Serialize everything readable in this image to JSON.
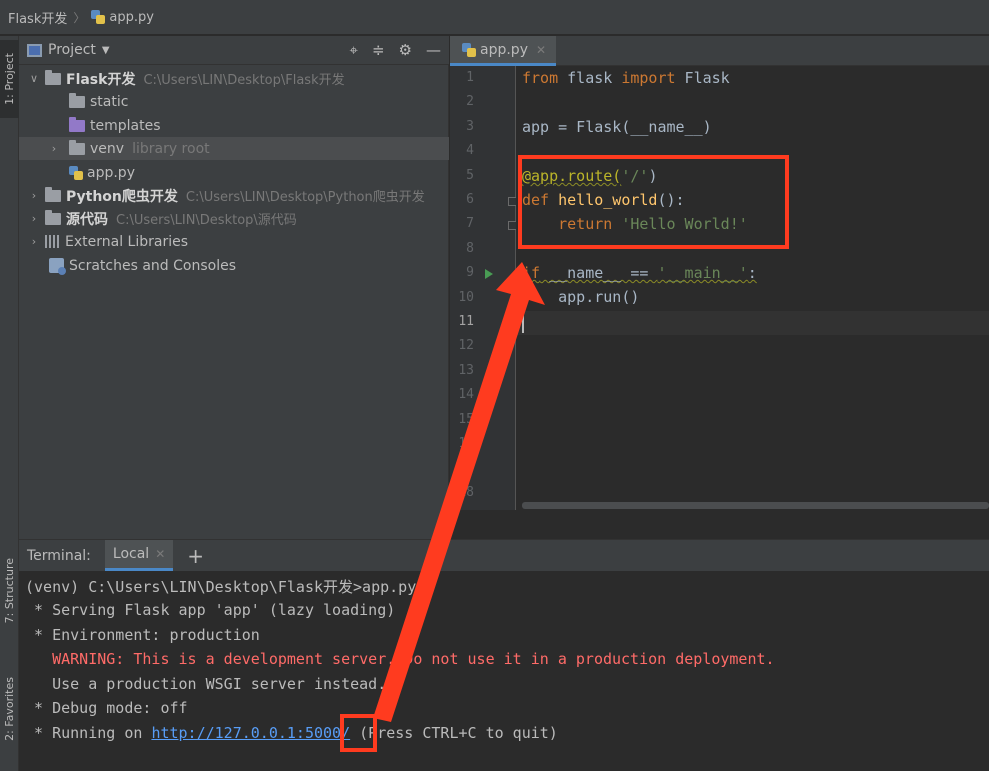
{
  "breadcrumb": {
    "project": "Flask开发",
    "file": "app.py"
  },
  "side_strip": {
    "project_tab": "1: Project",
    "structure_tab": "7: Structure",
    "favorites_tab": "2: Favorites"
  },
  "project_panel": {
    "title": "Project",
    "tree": [
      {
        "name": "Flask开发",
        "path": "C:\\Users\\LIN\\Desktop\\Flask开发"
      },
      {
        "name": "static"
      },
      {
        "name": "templates"
      },
      {
        "name": "venv",
        "note": "library root"
      },
      {
        "name": "app.py"
      },
      {
        "name": "Python爬虫开发",
        "path": "C:\\Users\\LIN\\Desktop\\Python爬虫开发"
      },
      {
        "name": "源代码",
        "path": "C:\\Users\\LIN\\Desktop\\源代码"
      },
      {
        "name": "External Libraries"
      },
      {
        "name": "Scratches and Consoles"
      }
    ]
  },
  "editor": {
    "tab_label": "app.py",
    "line_numbers": [
      "1",
      "2",
      "3",
      "4",
      "5",
      "6",
      "7",
      "8",
      "9",
      "10",
      "11",
      "12",
      "13",
      "14",
      "15",
      "16",
      "17",
      "18"
    ],
    "current_line": 11,
    "code": {
      "l1_from": "from",
      "l1_mod": " flask ",
      "l1_import": "import",
      "l1_name": " Flask",
      "l3": "app = Flask(__name__)",
      "l5_deco": "@app.route(",
      "l5_str": "'/'",
      "l5_close": ")",
      "l6_def": "def",
      "l6_fn": " hello_world",
      "l6_rest": "():",
      "l7_return": "return",
      "l7_str": " 'Hello World!'",
      "l9_if": "if",
      "l9_mid": " __name__ == ",
      "l9_str": "'__main__'",
      "l9_colon": ":",
      "l10": "    app.run()"
    }
  },
  "terminal": {
    "label": "Terminal:",
    "tab": "Local",
    "lines": {
      "prompt": "(venv) C:\\Users\\LIN\\Desktop\\Flask开发>app.py",
      "serving": " * Serving Flask app 'app' (lazy loading)",
      "env": " * Environment: production",
      "warning": "   WARNING: This is a development server. Do not use it in a production deployment.",
      "wsgi": "   Use a production WSGI server instead.",
      "debug": " * Debug mode: off",
      "running_pre": " * Running on ",
      "running_url": "http://127.0.0.1:5000/",
      "running_post": " (Press CTRL+C to quit)"
    }
  },
  "colors": {
    "annotation": "#ff3b1f",
    "accent": "#4a88c7",
    "link": "#589df6",
    "warning": "#ff6b68"
  }
}
